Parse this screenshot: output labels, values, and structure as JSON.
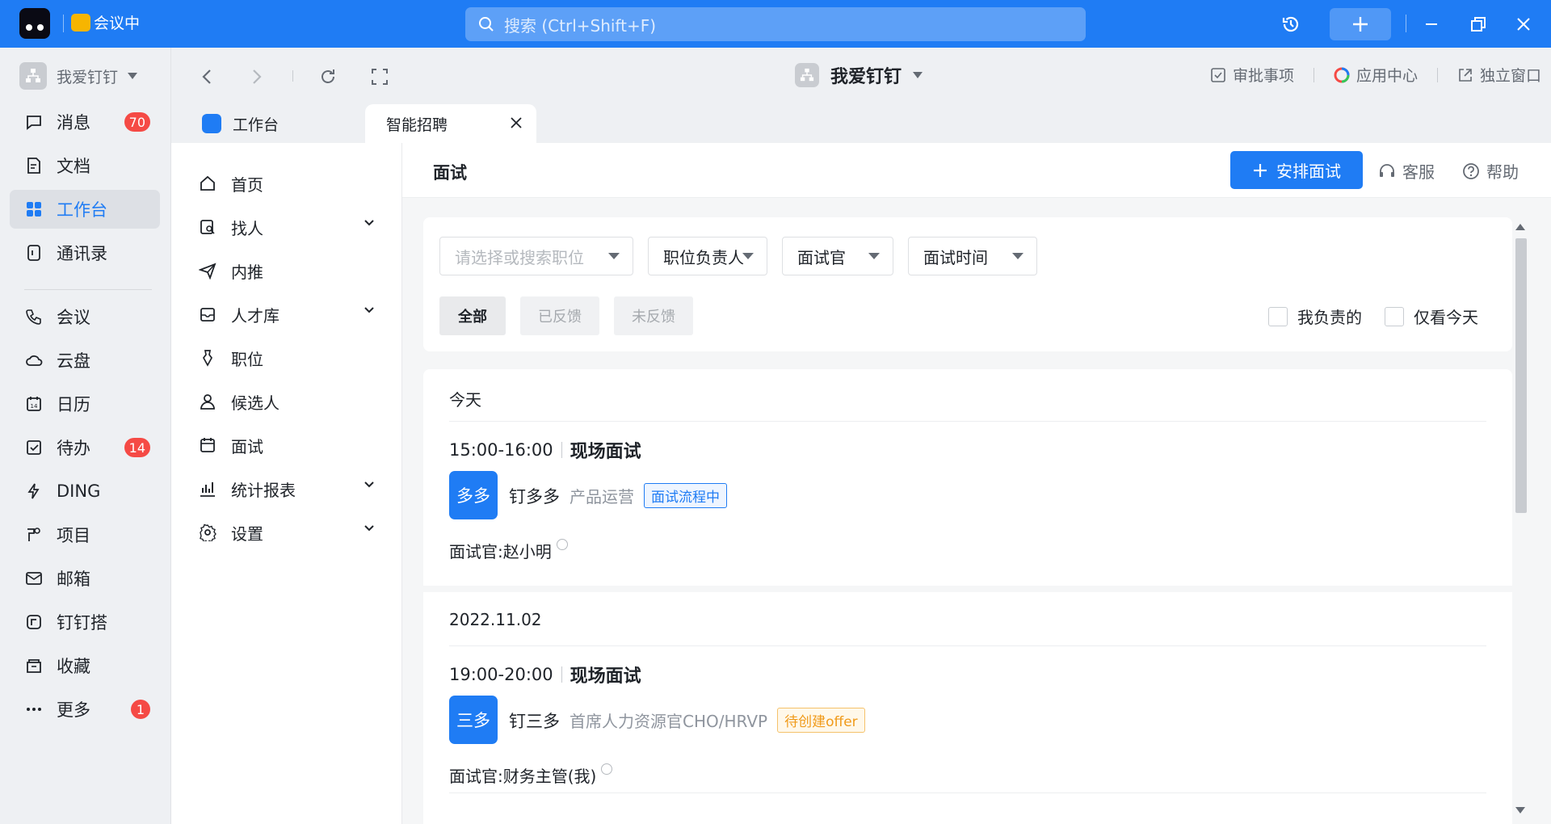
{
  "titlebar": {
    "meeting_label": "会议中",
    "search_placeholder": "搜索 (Ctrl+Shift+F)"
  },
  "leftnav": {
    "org_name": "我爱钉钉",
    "items": [
      {
        "label": "消息",
        "icon": "message-icon",
        "badge": "70"
      },
      {
        "label": "文档",
        "icon": "document-icon",
        "badge": ""
      },
      {
        "label": "工作台",
        "icon": "workbench-icon",
        "badge": "",
        "active": true
      },
      {
        "label": "通讯录",
        "icon": "contacts-icon",
        "badge": ""
      },
      {
        "label": "会议",
        "icon": "meeting-icon",
        "badge": ""
      },
      {
        "label": "云盘",
        "icon": "cloud-icon",
        "badge": ""
      },
      {
        "label": "日历",
        "icon": "calendar-icon",
        "badge": ""
      },
      {
        "label": "待办",
        "icon": "todo-icon",
        "badge": "14"
      },
      {
        "label": "DING",
        "icon": "ding-icon",
        "badge": ""
      },
      {
        "label": "项目",
        "icon": "project-icon",
        "badge": ""
      },
      {
        "label": "邮箱",
        "icon": "mail-icon",
        "badge": ""
      },
      {
        "label": "钉钉搭",
        "icon": "builder-icon",
        "badge": ""
      },
      {
        "label": "收藏",
        "icon": "favorites-icon",
        "badge": ""
      },
      {
        "label": "更多",
        "icon": "more-icon",
        "badge": "1"
      }
    ]
  },
  "toolbar": {
    "center_title": "我爱钉钉",
    "approval": "审批事项",
    "app_center": "应用中心",
    "standalone": "独立窗口"
  },
  "tabs": {
    "workbench": "工作台",
    "recruit": "智能招聘"
  },
  "subnav": {
    "items": [
      {
        "label": "首页",
        "icon": "home-icon",
        "expandable": false
      },
      {
        "label": "找人",
        "icon": "find-people-icon",
        "expandable": true
      },
      {
        "label": "内推",
        "icon": "referral-icon",
        "expandable": false
      },
      {
        "label": "人才库",
        "icon": "talent-pool-icon",
        "expandable": true
      },
      {
        "label": "职位",
        "icon": "position-icon",
        "expandable": false
      },
      {
        "label": "候选人",
        "icon": "candidate-icon",
        "expandable": false
      },
      {
        "label": "面试",
        "icon": "interview-icon",
        "expandable": false
      },
      {
        "label": "统计报表",
        "icon": "stats-icon",
        "expandable": true
      },
      {
        "label": "设置",
        "icon": "settings-icon",
        "expandable": true
      }
    ]
  },
  "main": {
    "title": "面试",
    "arrange_button": "安排面试",
    "service": "客服",
    "help": "帮助",
    "filters": {
      "position_placeholder": "请选择或搜索职位",
      "owner": "职位负责人",
      "interviewer": "面试官",
      "time": "面试时间"
    },
    "segments": {
      "all": "全部",
      "fed_back": "已反馈",
      "not_fed_back": "未反馈"
    },
    "checks": {
      "mine": "我负责的",
      "today_only": "仅看今天"
    },
    "groups": [
      {
        "day": "今天",
        "time": "15:00-16:00",
        "type": "现场面试",
        "avatar": "多多",
        "name": "钉多多",
        "role": "产品运营",
        "status": "面试流程中",
        "interviewer_label": "面试官:",
        "interviewer": "赵小明"
      },
      {
        "day": "2022.11.02",
        "time": "19:00-20:00",
        "type": "现场面试",
        "avatar": "三多",
        "name": "钉三多",
        "role": "首席人力资源官CHO/HRVP",
        "status": "待创建offer",
        "interviewer_label": "面试官:",
        "interviewer": "财务主管(我)"
      }
    ]
  },
  "colors": {
    "brand": "#1f7cf4",
    "badge": "#f54a45",
    "offer_tag": "#f09a1a"
  }
}
